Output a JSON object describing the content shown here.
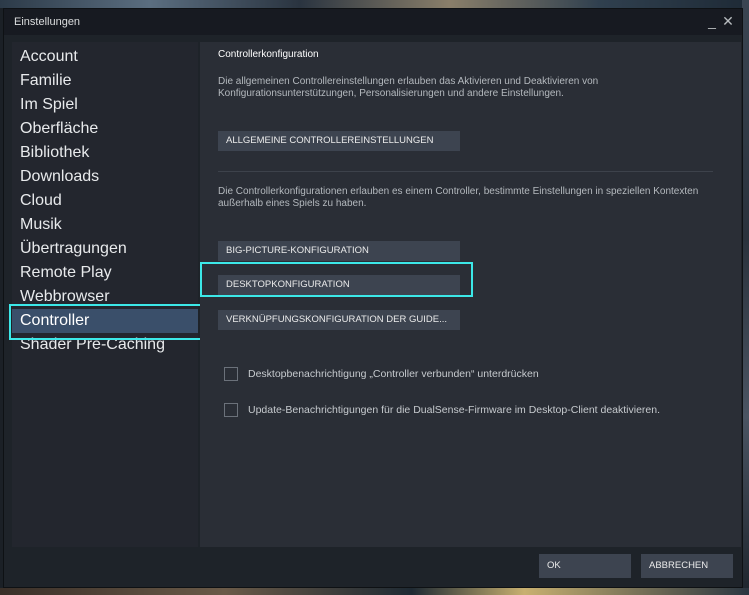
{
  "window": {
    "title": "Einstellungen",
    "minimize_glyph": "_",
    "close_glyph": "✕"
  },
  "sidebar": {
    "items": [
      {
        "label": "Account"
      },
      {
        "label": "Familie"
      },
      {
        "label": "Im Spiel"
      },
      {
        "label": "Oberfläche"
      },
      {
        "label": "Bibliothek"
      },
      {
        "label": "Downloads"
      },
      {
        "label": "Cloud"
      },
      {
        "label": "Musik"
      },
      {
        "label": "Übertragungen"
      },
      {
        "label": "Remote Play"
      },
      {
        "label": "Webbrowser"
      },
      {
        "label": "Controller"
      },
      {
        "label": "Shader Pre-Caching"
      }
    ],
    "active": "Controller"
  },
  "main": {
    "section_title": "Controllerkonfiguration",
    "description_general": "Die allgemeinen Controllereinstellungen erlauben das Aktivieren und Deaktivieren von Konfigurationsunterstützungen, Personalisierungen und andere Einstellungen.",
    "button_general": "ALLGEMEINE CONTROLLEREINSTELLUNGEN",
    "description_configs": "Die Controllerkonfigurationen erlauben es einem Controller, bestimmte Einstellungen in speziellen Kontexten außerhalb eines Spiels zu haben.",
    "button_big_picture": "BIG-PICTURE-KONFIGURATION",
    "button_desktop": "DESKTOPKONFIGURATION",
    "button_guide": "VERKNÜPFUNGSKONFIGURATION DER GUIDE...",
    "checkbox_notification": "Desktopbenachrichtigung „Controller verbunden“ unterdrücken",
    "checkbox_dualsense": "Update-Benachrichtigungen für die DualSense-Firmware im Desktop-Client deaktivieren."
  },
  "footer": {
    "ok": "OK",
    "cancel": "ABBRECHEN"
  },
  "colors": {
    "accent_highlight": "#3ce8e8",
    "active_nav": "#3a4f6a",
    "button_bg": "#3d4450"
  }
}
